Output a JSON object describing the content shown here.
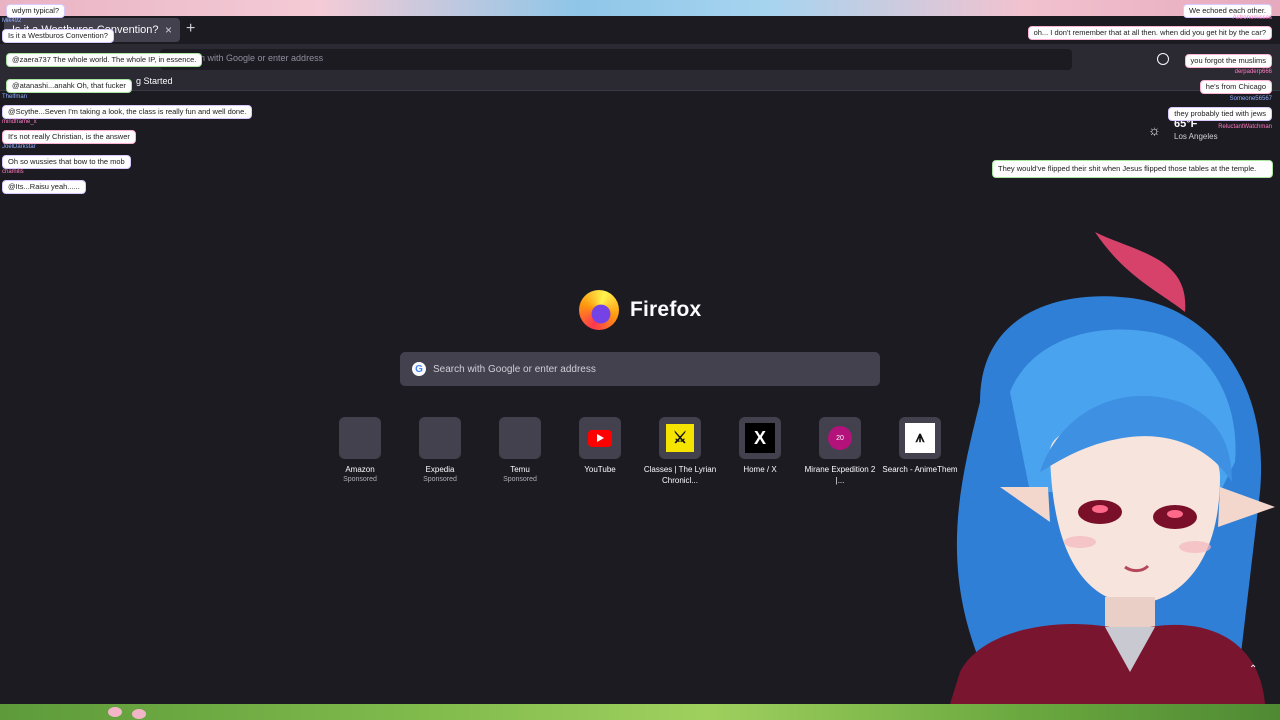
{
  "browser": {
    "tab_title": "Is it a Westburos Convention?",
    "tab_close": "×",
    "new_tab": "+",
    "url_placeholder": "h with Google or enter address",
    "bookmark_text": "g Started"
  },
  "newtab": {
    "brand": "Firefox",
    "search_placeholder": "Search with Google or enter address",
    "sites": [
      {
        "label": "Amazon",
        "sub": "Sponsored"
      },
      {
        "label": "Expedia",
        "sub": "Sponsored"
      },
      {
        "label": "Temu",
        "sub": "Sponsored"
      },
      {
        "label": "YouTube",
        "sub": ""
      },
      {
        "label": "Classes | The Lyrian Chronicl...",
        "sub": ""
      },
      {
        "label": "Home / X",
        "sub": ""
      },
      {
        "label": "Mirane Expedition 2 |...",
        "sub": ""
      },
      {
        "label": "Search - AnimeThem",
        "sub": ""
      }
    ],
    "mirane_badge": "20"
  },
  "weather": {
    "temp": "65°F",
    "city": "Los Angeles"
  },
  "chat_left": [
    {
      "user": "",
      "text": "wdym typical?"
    },
    {
      "user": "Mik492",
      "text": "Is it a Westburos Convention?"
    },
    {
      "user": "",
      "text": "@zaera737 The whole world. The whole IP, in essence."
    },
    {
      "user": "",
      "text": "@atanashi...anahk Oh, that fucker"
    },
    {
      "user": "Thelfman",
      "text": "@Scythe...Seven I'm taking a look, the class is really fun and well done."
    },
    {
      "user": "mindframe_x",
      "text": "It's not really Christian, is the answer"
    },
    {
      "user": "JoelDarkstar",
      "text": "Oh so wussies that bow to the mob"
    },
    {
      "user": "chamilis",
      "text": "@Its...Raisu yeah......"
    }
  ],
  "chat_right": [
    {
      "user": "",
      "text": "We echoed each other."
    },
    {
      "user": "Astronomisses",
      "text": "oh... I don't remember that at all then. when did you get hit by the car?"
    },
    {
      "user": "",
      "text": "you forgot the muslims"
    },
    {
      "user": "derpaderp666",
      "text": "he's from Chicago"
    },
    {
      "user": "Someone56567",
      "text": "they probably tied with jews"
    },
    {
      "user": "ReluctantWatchman",
      "text": ""
    },
    {
      "user": "",
      "text": "They would've flipped their shit when Jesus flipped those tables at the temple."
    }
  ]
}
